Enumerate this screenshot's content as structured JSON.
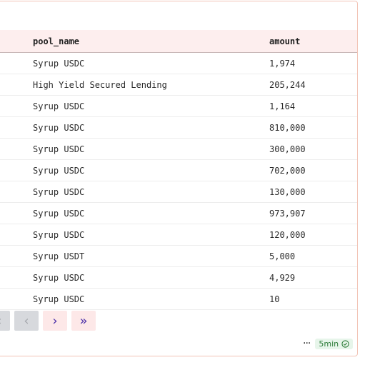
{
  "table": {
    "columns": [
      "pool_name",
      "amount"
    ],
    "rows": [
      {
        "pool_name": "Syrup USDC",
        "amount": "1,974"
      },
      {
        "pool_name": "High Yield Secured Lending",
        "amount": "205,244"
      },
      {
        "pool_name": "Syrup USDC",
        "amount": "1,164"
      },
      {
        "pool_name": "Syrup USDC",
        "amount": "810,000"
      },
      {
        "pool_name": "Syrup USDC",
        "amount": "300,000"
      },
      {
        "pool_name": "Syrup USDC",
        "amount": "702,000"
      },
      {
        "pool_name": "Syrup USDC",
        "amount": "130,000"
      },
      {
        "pool_name": "Syrup USDC",
        "amount": "973,907"
      },
      {
        "pool_name": "Syrup USDC",
        "amount": "120,000"
      },
      {
        "pool_name": "Syrup USDT",
        "amount": "5,000"
      },
      {
        "pool_name": "Syrup USDC",
        "amount": "4,929"
      },
      {
        "pool_name": "Syrup USDC",
        "amount": "10"
      }
    ]
  },
  "pagination": {
    "first_icon": "double-chevron-left-icon",
    "prev_icon": "chevron-left-icon",
    "next_icon": "chevron-right-icon",
    "last_icon": "double-chevron-right-icon"
  },
  "footer": {
    "more_label": "···",
    "refresh_badge": "5min",
    "status_icon": "check-circle-icon"
  },
  "colors": {
    "border": "#f2c4b6",
    "header_bg": "#fdeeee",
    "accent": "#4b2fa8",
    "badge_bg": "#e7f5ea",
    "badge_text": "#2f7d3b"
  }
}
